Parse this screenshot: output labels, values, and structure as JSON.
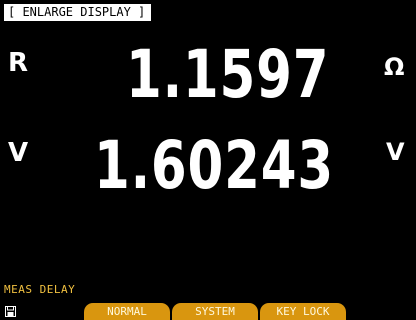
{
  "header": {
    "title": "[ ENLARGE DISPLAY ]"
  },
  "readings": {
    "r": {
      "label": "R",
      "value": "1.1597",
      "unit": "Ω"
    },
    "v": {
      "label": "V",
      "value": "1.60243",
      "unit": "V"
    }
  },
  "status": {
    "text": "MEAS DELAY",
    "icon": "save-icon"
  },
  "softkeys": [
    {
      "label": "NORMAL"
    },
    {
      "label": "SYSTEM"
    },
    {
      "label": "KEY LOCK"
    }
  ],
  "colors": {
    "background": "#000000",
    "text": "#ffffff",
    "status": "#f0c040",
    "softkey": "#d9960f"
  }
}
